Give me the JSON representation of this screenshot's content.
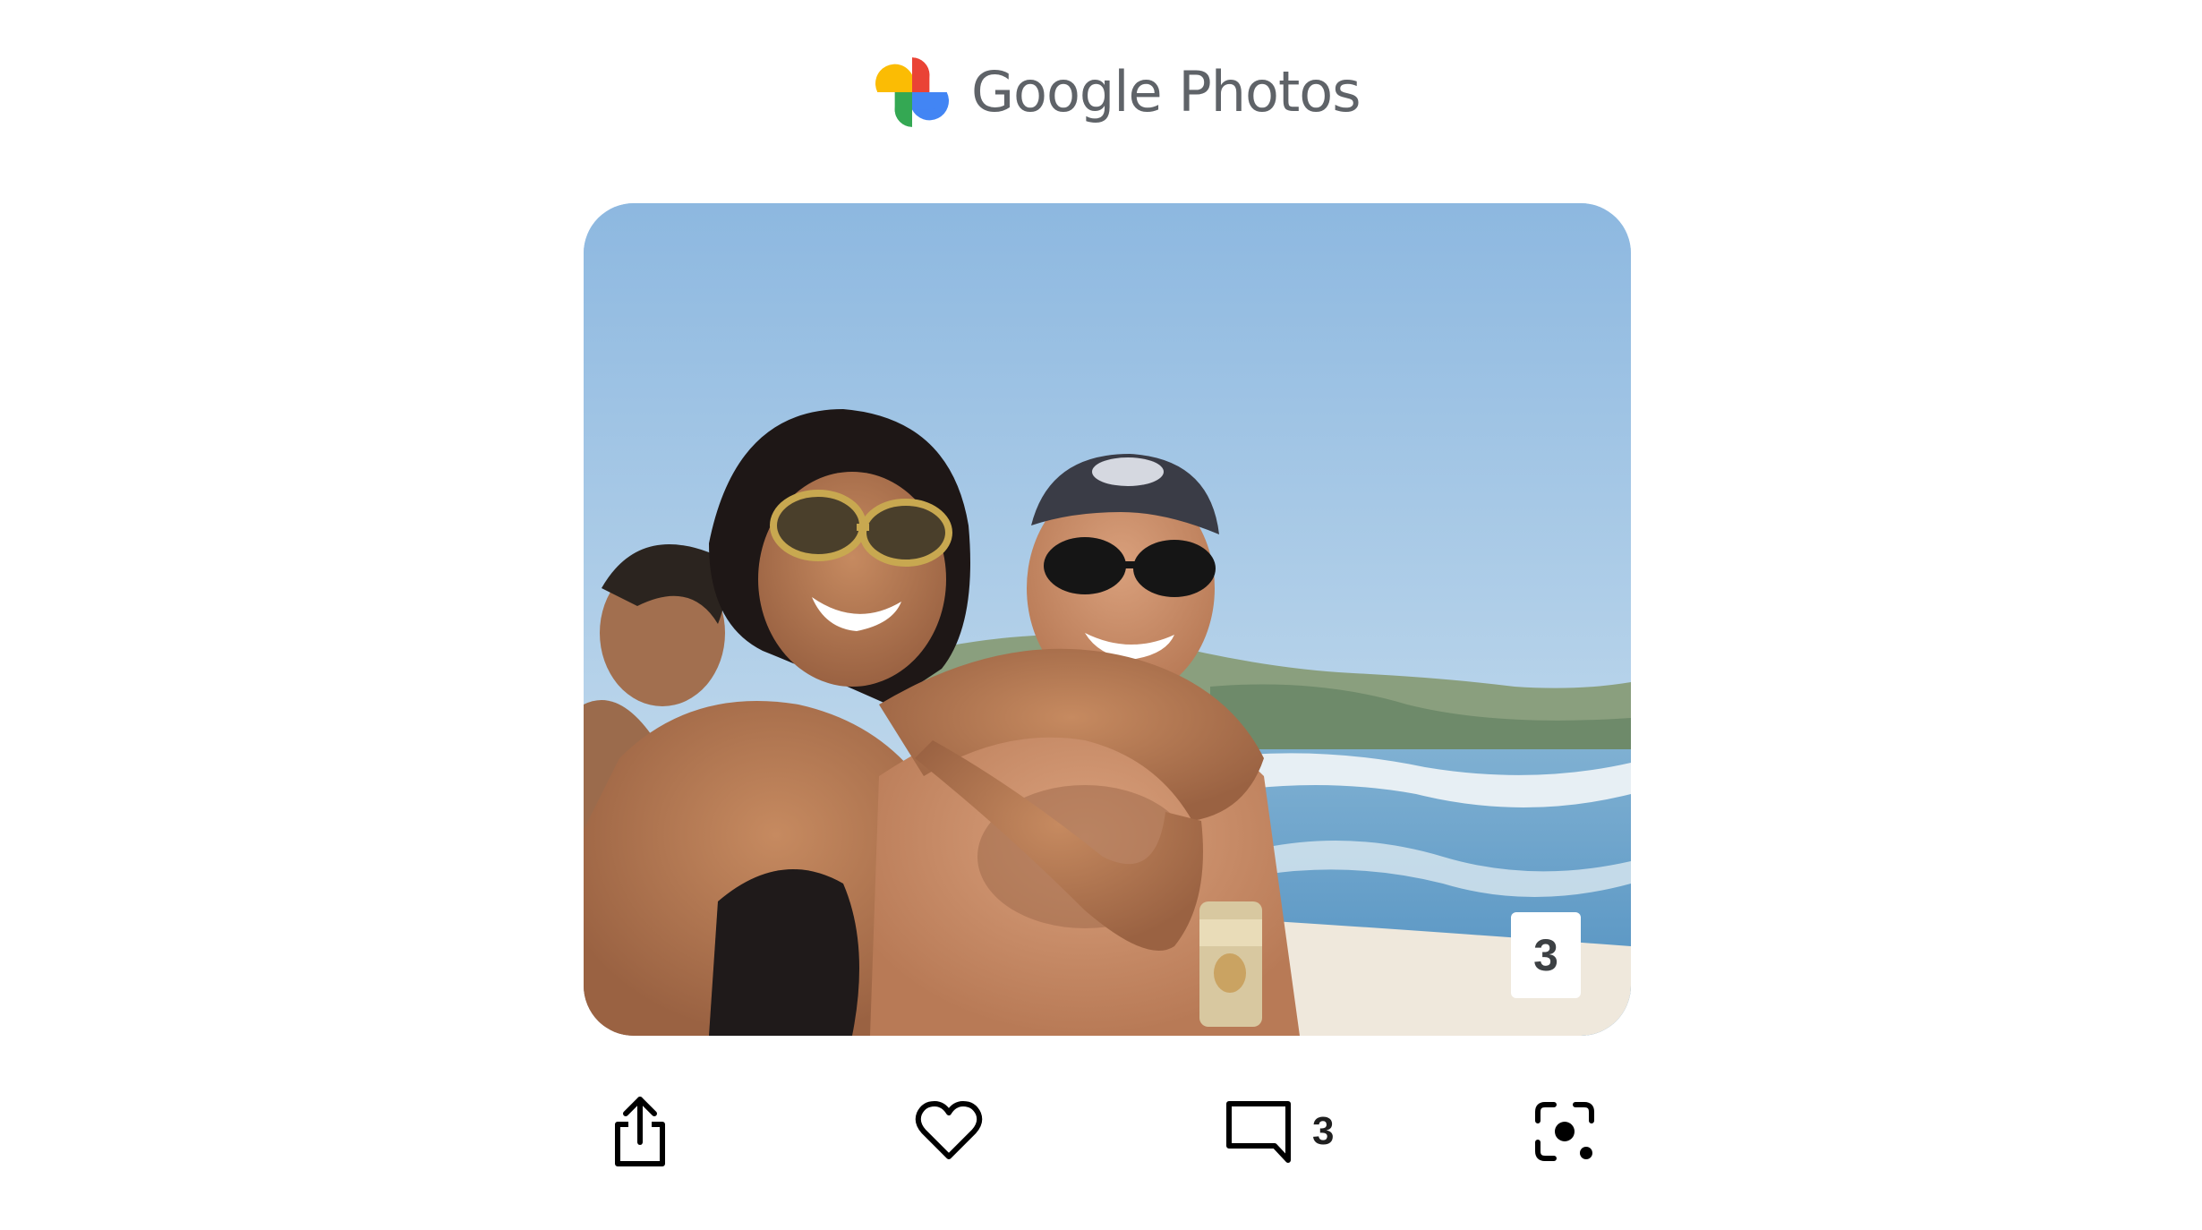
{
  "header": {
    "wordmark": "Google Photos",
    "logo_colors": [
      "#ea4335",
      "#fbbc04",
      "#34a853",
      "#4285f4"
    ]
  },
  "photo": {
    "description_visible": false,
    "counter_badge": "3"
  },
  "actions": {
    "share_icon": "share-icon",
    "like_icon": "heart-icon",
    "comment_icon": "comment-icon",
    "comment_count": "3",
    "lens_icon": "lens-icon"
  }
}
